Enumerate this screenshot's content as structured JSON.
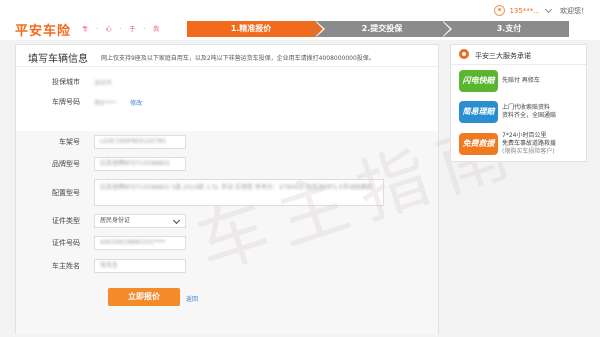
{
  "header": {
    "logo": "平安车险",
    "slogan": "专 · 心 · 于 · 我",
    "user_phone": "135***...",
    "welcome": "欢迎您！"
  },
  "steps": [
    {
      "label": "1.精准报价",
      "active": true
    },
    {
      "label": "2.提交投保",
      "active": false
    },
    {
      "label": "3.支付",
      "active": false
    }
  ],
  "form": {
    "title": "填写车辆信息",
    "description": "网上仅支持9座及以下家庭自用车，以及2吨以下非营运货车投保，企业用车请拨打4008000000投保。",
    "fields": {
      "city": {
        "label": "投保城市",
        "value": "深圳市"
      },
      "plate": {
        "label": "车牌号码",
        "value": "粤B****",
        "link": "修改"
      },
      "frame": {
        "label": "车架号",
        "value": "LGXC16DF9E0120785"
      },
      "brand": {
        "label": "品牌型号",
        "value": "比亚迪牌BYD7150WAEG"
      },
      "config": {
        "label": "配置型号",
        "value": "比亚迪牌BYD7150WAEG 5座 2014款 1.5L 手动 实用型 参考价：47900元 比亚迪F3 1.5手动经典款"
      },
      "id_type": {
        "label": "证件类型",
        "value": "居民身份证"
      },
      "id_number": {
        "label": "证件号码",
        "value": "44030619880101****"
      },
      "owner": {
        "label": "车主姓名",
        "value": "张先生"
      }
    },
    "submit_label": "立即报价",
    "back_label": "返回"
  },
  "watermark": "车主指南",
  "side": {
    "title": "平安三大服务承诺",
    "promises": [
      {
        "badge": "闪电快赔",
        "color": "#5cb531",
        "lines": [
          "先赔付 再修车"
        ]
      },
      {
        "badge": "简易理赔",
        "color": "#2a8fd0",
        "lines": [
          "上门代收索赔资料",
          "资料齐全，全国通赔"
        ]
      },
      {
        "badge": "免费救援",
        "color": "#f07a21",
        "lines": [
          "7*24小时百公里",
          "免费车事故道路救援",
          "(限购买车损险客户)"
        ]
      }
    ]
  }
}
